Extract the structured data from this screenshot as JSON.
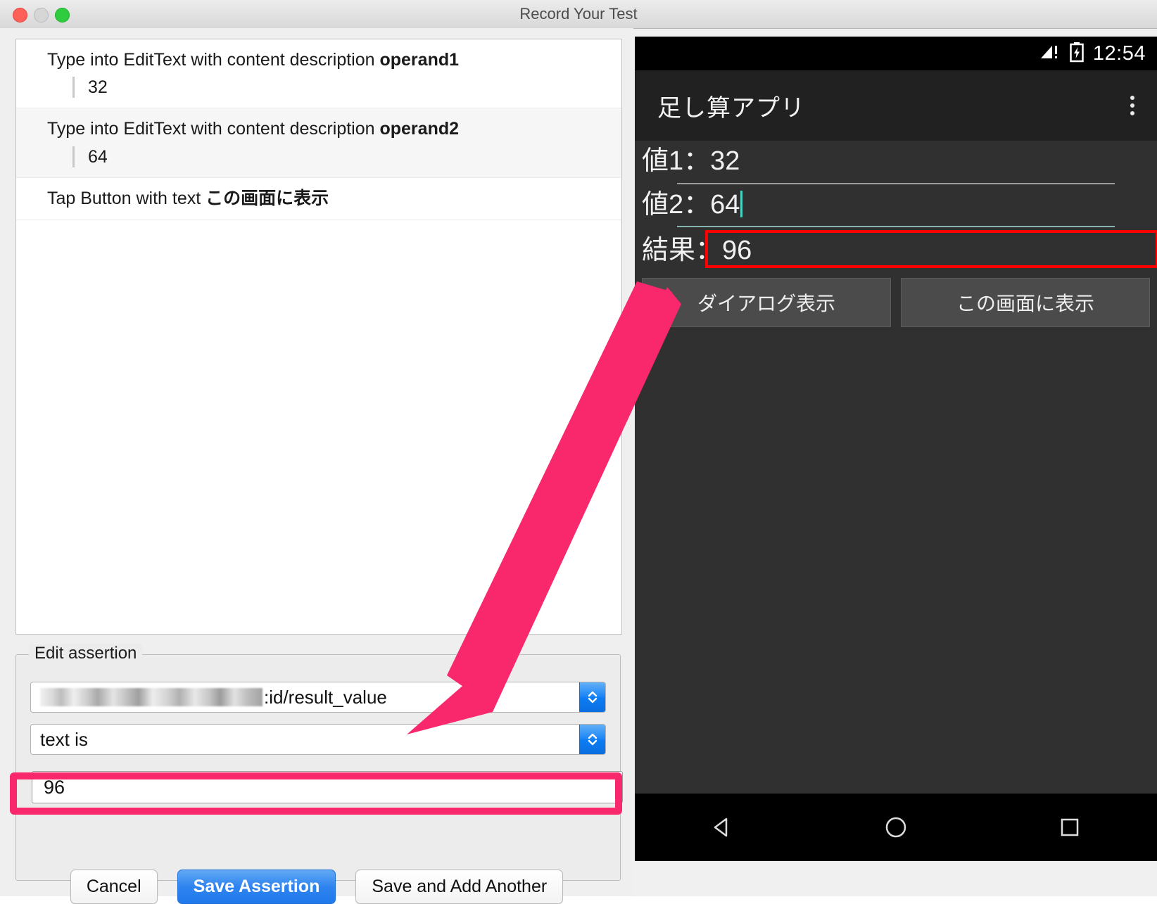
{
  "window": {
    "title": "Record Your Test",
    "traffic_lights": [
      "close-red",
      "minimize-gray",
      "zoom-green"
    ]
  },
  "steps": [
    {
      "prefix": "Type into EditText with content description ",
      "target": "operand1",
      "value": "32"
    },
    {
      "prefix": "Type into EditText with content description ",
      "target": "operand2",
      "value": "64"
    },
    {
      "prefix": "Tap Button with text ",
      "target": "この画面に表示",
      "value": ""
    }
  ],
  "assertion": {
    "legend": "Edit assertion",
    "element_selector": ":id/result_value",
    "element_selector_blurred": true,
    "matcher": "text is",
    "value": "96"
  },
  "buttons": {
    "cancel": "Cancel",
    "save_assertion": "Save Assertion",
    "save_and_add_another": "Save and Add Another"
  },
  "device": {
    "status_bar": {
      "time": "12:54",
      "signal_icon": "signal-warning-icon",
      "battery_icon": "battery-charging-icon"
    },
    "app_bar": {
      "title": "足し算アプリ",
      "overflow_icon": "overflow-menu-icon"
    },
    "fields": [
      {
        "label": "値1：32",
        "focused": false,
        "caret": false
      },
      {
        "label": "値2：64",
        "focused": true,
        "caret": true
      }
    ],
    "result": {
      "label": "結果：96",
      "highlighted": true,
      "highlight_color": "#ff0000"
    },
    "app_buttons": [
      "ダイアログ表示",
      "この画面に表示"
    ],
    "nav_bar": [
      "back-icon",
      "home-icon",
      "recents-icon"
    ]
  },
  "annotation": {
    "arrow_color": "#f9276b",
    "highlight_color": "#f9276b"
  }
}
